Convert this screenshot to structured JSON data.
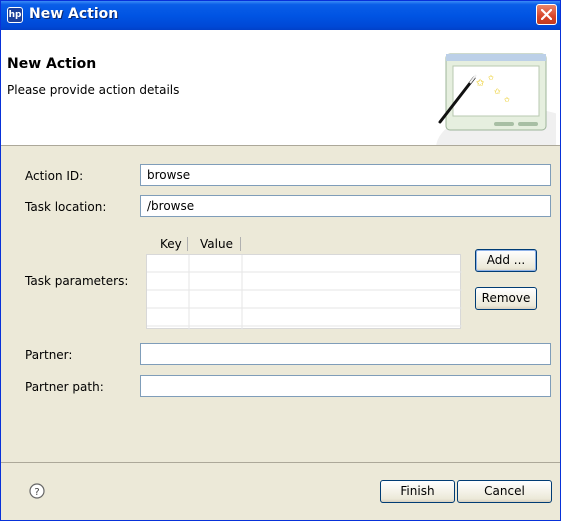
{
  "window": {
    "title": "New Action"
  },
  "banner": {
    "title": "New Action",
    "description": "Please provide action details"
  },
  "form": {
    "action_id": {
      "label": "Action ID:",
      "value": "browse"
    },
    "task_location": {
      "label": "Task location:",
      "value": "/browse"
    },
    "task_parameters": {
      "label": "Task parameters:",
      "columns": [
        "Key",
        "Value"
      ],
      "rows": [],
      "add_label": "Add ...",
      "remove_label": "Remove"
    },
    "partner": {
      "label": "Partner:",
      "value": ""
    },
    "partner_path": {
      "label": "Partner path:",
      "value": ""
    }
  },
  "footer": {
    "finish_label": "Finish",
    "cancel_label": "Cancel"
  },
  "icons": [
    "app-icon",
    "close-icon",
    "wizard-banner-icon",
    "help-icon"
  ]
}
